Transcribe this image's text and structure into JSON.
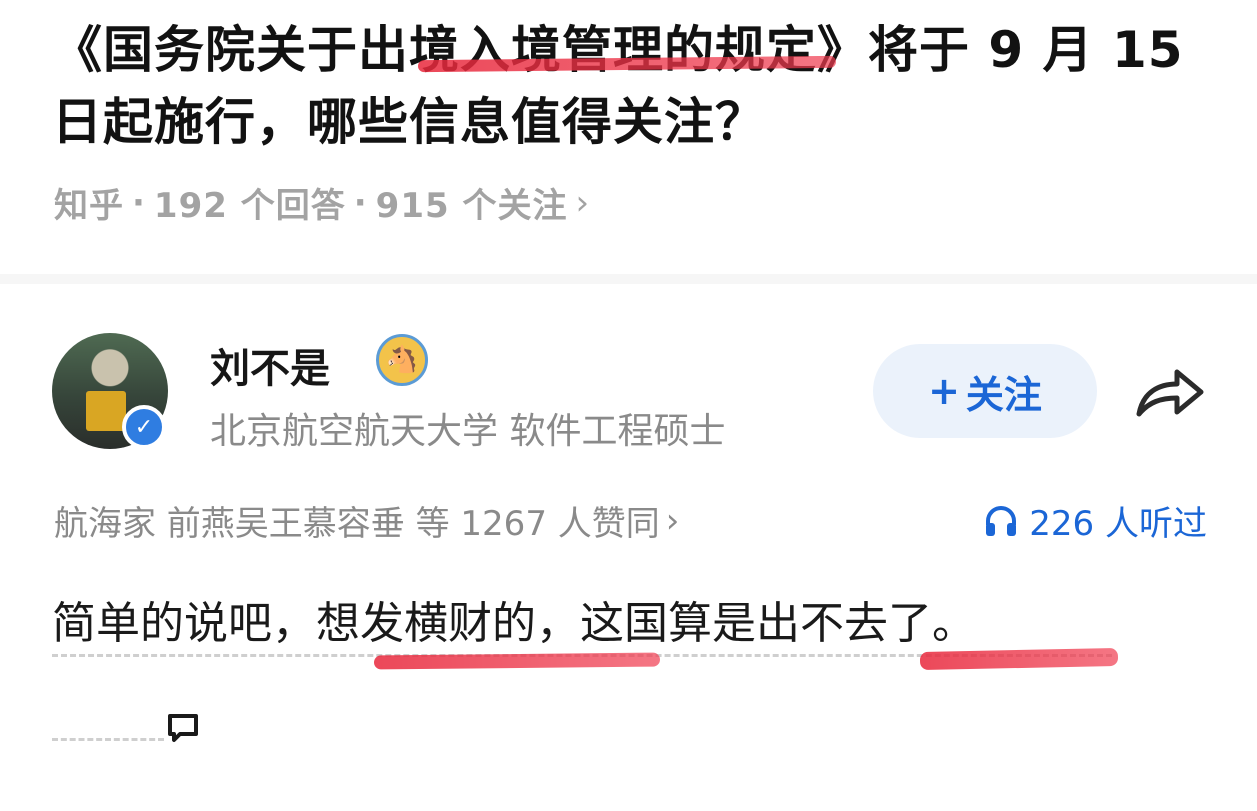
{
  "question": {
    "title": "《国务院关于出境入境管理的规定》将于 9 月 15 日起施行，哪些信息值得关注？",
    "meta": {
      "source": "知乎",
      "separator": "·",
      "answers": "192 个回答",
      "followers": "915 个关注",
      "chevron": "›"
    }
  },
  "author": {
    "name": "刘不是",
    "bio": "北京航空航天大学 软件工程硕士",
    "avatar_icon": "avatar",
    "verified_icon": "verified-check-icon",
    "badge_icon": "cartoon-badge-icon"
  },
  "follow_button": {
    "label": "关注",
    "plus": "+"
  },
  "share_icon": "share-arrow-icon",
  "stats": {
    "upvotes_text": "航海家 前燕吴王慕容垂 等 1267 人赞同",
    "upvotes_chevron": "›",
    "listened_text": "226 人听过",
    "listened_icon": "headphones-icon"
  },
  "answer": {
    "text": "简单的说吧，想发横财的，这国算是出不去了。",
    "comment_icon": "comment-bubble-icon"
  },
  "colors": {
    "accent": "#1b66d6",
    "highlight_red": "#e8283c",
    "meta_gray": "#a3a3a3",
    "follow_bg": "#ebf2fb"
  }
}
